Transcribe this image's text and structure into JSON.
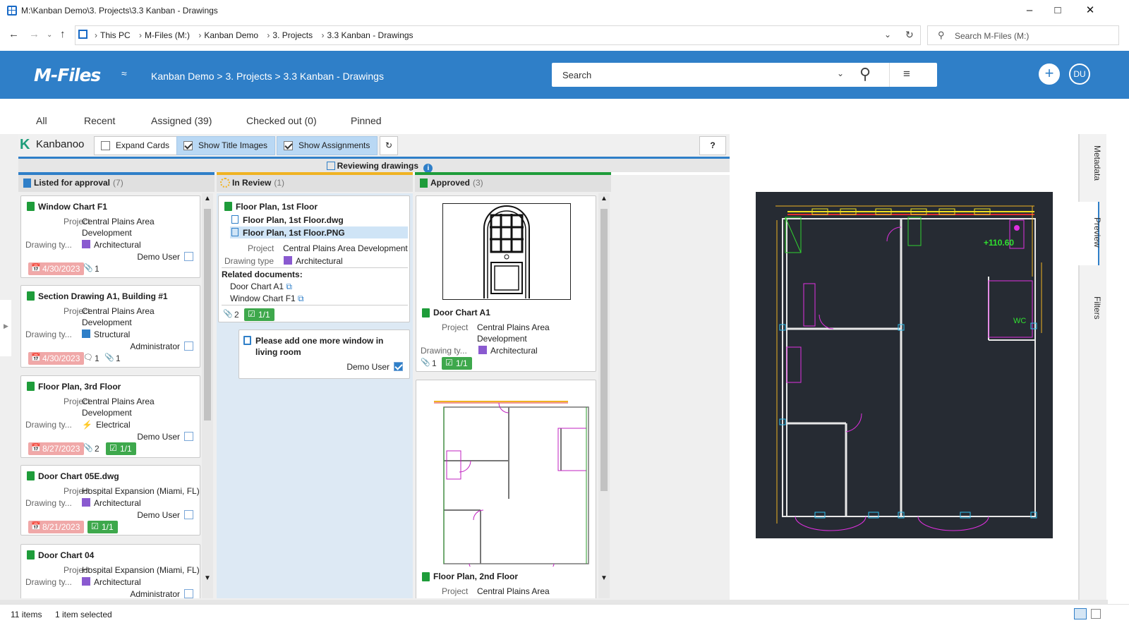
{
  "window": {
    "title": "M:\\Kanban Demo\\3. Projects\\3.3 Kanban - Drawings"
  },
  "address": {
    "crumbs": [
      "This PC",
      "M-Files (M:)",
      "Kanban Demo",
      "3. Projects",
      "3.3 Kanban - Drawings"
    ],
    "search_placeholder": "Search M-Files (M:)"
  },
  "header": {
    "logo": "M-Files",
    "path": "Kanban Demo > 3. Projects > 3.3 Kanban - Drawings",
    "search_placeholder": "Search",
    "user_initials": "DU"
  },
  "tabs": [
    "All",
    "Recent",
    "Assigned (39)",
    "Checked out (0)",
    "Pinned"
  ],
  "kanbanoo": {
    "brand": "Kanbanoo",
    "expand_cards": "Expand Cards",
    "show_title_images": "Show Title Images",
    "show_assignments": "Show Assignments",
    "help": "?",
    "swimlane": "Reviewing drawings",
    "accent": "#2f7fc8"
  },
  "columns": [
    {
      "name": "Listed for approval",
      "count": "(7)",
      "color": "#2f7fc8"
    },
    {
      "name": "In Review",
      "count": "(1)",
      "color": "#f0b323"
    },
    {
      "name": "Approved",
      "count": "(3)",
      "color": "#1e9c3a"
    }
  ],
  "labels": {
    "project": "Project",
    "drawing_type_short": "Drawing ty...",
    "drawing_type": "Drawing type",
    "related_documents": "Related documents:"
  },
  "cards_listed": [
    {
      "title": "Window Chart F1",
      "project_l1": "Central Plains Area",
      "project_l2": "Development",
      "type": "Architectural",
      "user": "Demo User",
      "date": "4/30/2023",
      "attach": "1"
    },
    {
      "title": "Section Drawing A1, Building #1",
      "project_l1": "Central Plains Area",
      "project_l2": "Development",
      "type": "Structural",
      "user": "Administrator",
      "date": "4/30/2023",
      "comments": "1",
      "attach": "1"
    },
    {
      "title": "Floor Plan, 3rd Floor",
      "project_l1": "Central Plains Area",
      "project_l2": "Development",
      "type": "Electrical",
      "user": "Demo User",
      "date": "8/27/2023",
      "attach": "2",
      "check": "1/1"
    },
    {
      "title": "Door Chart 05E.dwg",
      "project_l1": "Hospital Expansion (Miami, FL)",
      "type": "Architectural",
      "user": "Demo User",
      "date": "8/21/2023",
      "check": "1/1"
    },
    {
      "title": "Door Chart 04",
      "project_l1": "Hospital Expansion (Miami, FL)",
      "type": "Architectural",
      "user": "Administrator"
    }
  ],
  "card_review": {
    "title": "Floor Plan, 1st Floor",
    "files": [
      "Floor Plan, 1st Floor.dwg",
      "Floor Plan, 1st Floor.PNG"
    ],
    "project": "Central Plains Area Development",
    "type": "Architectural",
    "related": [
      "Door Chart A1",
      "Window Chart F1"
    ],
    "attach": "2",
    "check": "1/1"
  },
  "assignment": {
    "title": "Please add one more window in living room",
    "user": "Demo User"
  },
  "cards_approved": [
    {
      "title": "Door Chart A1",
      "project_l1": "Central Plains Area",
      "project_l2": "Development",
      "type": "Architectural",
      "attach": "1",
      "check": "1/1"
    },
    {
      "title": "Floor Plan, 2nd Floor",
      "project_l1": "Central Plains Area"
    }
  ],
  "preview_tabs": [
    "Metadata",
    "Preview",
    "Filters"
  ],
  "cad_label": "+110.60",
  "cad_wc": "WC",
  "status": {
    "items": "11 items",
    "selected": "1 item selected"
  }
}
